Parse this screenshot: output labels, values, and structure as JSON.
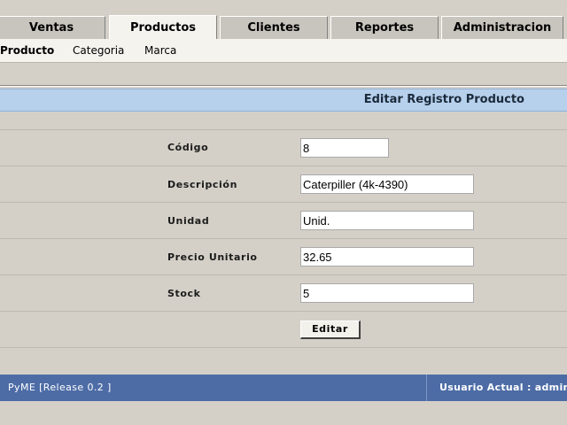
{
  "nav": {
    "tabs": [
      {
        "label": "Ventas"
      },
      {
        "label": "Productos"
      },
      {
        "label": "Clientes"
      },
      {
        "label": "Reportes"
      },
      {
        "label": "Administracion"
      }
    ],
    "active_tab": "Productos"
  },
  "subnav": {
    "items": [
      {
        "label": "Producto"
      },
      {
        "label": "Categoria"
      },
      {
        "label": "Marca"
      }
    ],
    "active_item": "Producto"
  },
  "form": {
    "title": "Editar Registro Producto",
    "fields": [
      {
        "label": "Código",
        "value": "8"
      },
      {
        "label": "Descripción",
        "value": "Caterpiller (4k-4390)"
      },
      {
        "label": "Unidad",
        "value": "Unid."
      },
      {
        "label": "Precio Unitario",
        "value": "32.65"
      },
      {
        "label": "Stock",
        "value": "5"
      }
    ],
    "submit_label": "Editar"
  },
  "footer": {
    "app": "PyME [Release 0.2 ]",
    "user": "Usuario Actual : admin  ["
  },
  "colors": {
    "header_band": "#b7d0ec",
    "footer": "#4d6ca6",
    "background": "#d4d0c8"
  }
}
